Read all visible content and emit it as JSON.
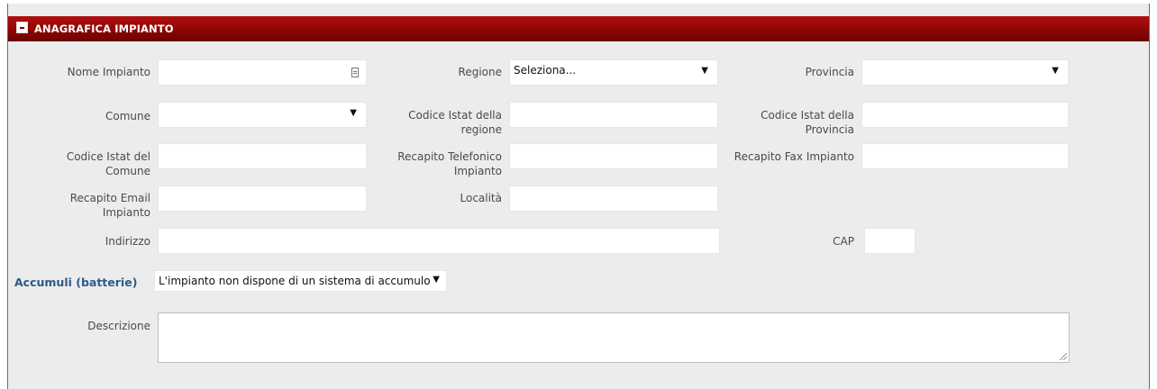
{
  "section": {
    "title": "ANAGRAFICA IMPIANTO"
  },
  "labels": {
    "nome_impianto": "Nome Impianto",
    "regione": "Regione",
    "provincia": "Provincia",
    "comune": "Comune",
    "istat_regione_l1": "Codice Istat della",
    "istat_regione_l2": "regione",
    "istat_provincia_l1": "Codice Istat della",
    "istat_provincia_l2": "Provincia",
    "istat_comune_l1": "Codice Istat del",
    "istat_comune_l2": "Comune",
    "tel_l1": "Recapito Telefonico",
    "tel_l2": "Impianto",
    "fax": "Recapito Fax Impianto",
    "email_l1": "Recapito Email",
    "email_l2": "Impianto",
    "localita": "Località",
    "indirizzo": "Indirizzo",
    "cap": "CAP",
    "accumuli": "Accumuli (batterie)",
    "descrizione": "Descrizione"
  },
  "values": {
    "regione_select": "Seleziona...",
    "provincia_select": "",
    "comune_select": "",
    "accumuli_select": "L'impianto non dispone di un sistema di accumulo"
  },
  "icons": {
    "dropdown": "▼"
  }
}
